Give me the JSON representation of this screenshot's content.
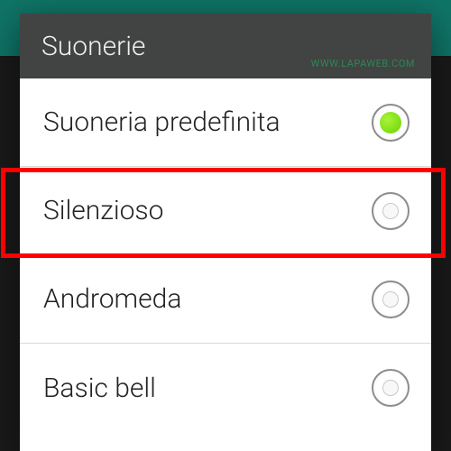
{
  "dialog": {
    "title": "Suonerie",
    "watermark": "WWW.LAPAWEB.COM"
  },
  "options": [
    {
      "label": "Suoneria predefinita",
      "selected": true
    },
    {
      "label": "Silenzioso",
      "selected": false
    },
    {
      "label": "Andromeda",
      "selected": false
    },
    {
      "label": "Basic bell",
      "selected": false
    }
  ],
  "highlighted_index": 1
}
